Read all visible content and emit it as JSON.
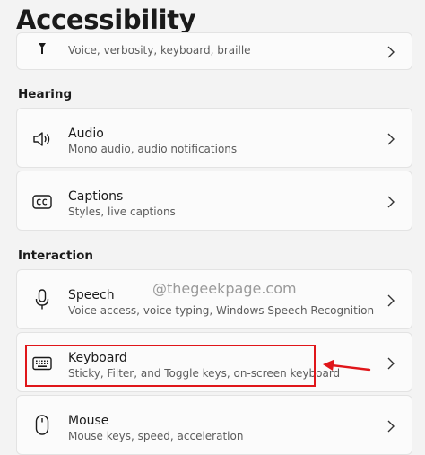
{
  "page": {
    "title": "Accessibility"
  },
  "vision_item": {
    "description": "Voice, verbosity, keyboard, braille",
    "icon": "narrator-icon"
  },
  "sections": {
    "hearing": {
      "label": "Hearing",
      "items": [
        {
          "title": "Audio",
          "description": "Mono audio, audio notifications",
          "icon": "speaker-icon"
        },
        {
          "title": "Captions",
          "description": "Styles, live captions",
          "icon": "closed-captions-icon"
        }
      ]
    },
    "interaction": {
      "label": "Interaction",
      "items": [
        {
          "title": "Speech",
          "description": "Voice access, voice typing, Windows Speech Recognition",
          "icon": "microphone-icon"
        },
        {
          "title": "Keyboard",
          "description": "Sticky, Filter, and Toggle keys, on-screen keyboard",
          "icon": "keyboard-icon"
        },
        {
          "title": "Mouse",
          "description": "Mouse keys, speed, acceleration",
          "icon": "mouse-icon"
        }
      ]
    }
  },
  "watermark": "@thegeekpage.com",
  "colors": {
    "background": "#f3f3f3",
    "card": "#fbfbfb",
    "highlight": "#e0161a"
  }
}
